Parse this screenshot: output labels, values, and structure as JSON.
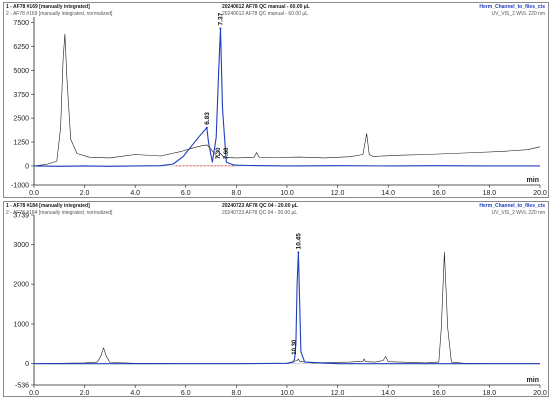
{
  "panels": [
    {
      "header": {
        "series1_label": "1 - AF78 #169  [manually integrated]",
        "series2_label": "2 - AF78 #169  [manually integrated, normalized]",
        "run1": "20240612 AF78 QC manual  -  60.00 µL",
        "run2": "20240612 AF78 QC manual  -  60.00 µL",
        "channel1": "Herm_Channel_to_files_cts",
        "channel2": "UV_VIS_2 WVL 220 nm"
      },
      "y_tick_labels": [
        "7500",
        "6250",
        "5000",
        "3750",
        "2500",
        "1250",
        "0",
        "-1000"
      ],
      "x_tick_labels": [
        "0.0",
        "2.0",
        "4.0",
        "6.0",
        "8.0",
        "10.0",
        "12.0",
        "14.0",
        "16.0",
        "18.0",
        "20.0"
      ],
      "x_unit": "min",
      "peak_labels": [
        "6.83",
        "7.37",
        "7.30",
        "7.60"
      ]
    },
    {
      "header": {
        "series1_label": "1 - AF78 #184  [manually integrated]",
        "series2_label": "2 - AF78 #184  [manually integrated, normalized]",
        "run1": "20240723 AF78 QC 04  -  20.00 µL",
        "run2": "20240723 AF78 QC 04  -  20.00 µL",
        "channel1": "Herm_Channel_to_files_cts",
        "channel2": "UV_VIS_2 WVL 220 nm"
      },
      "y_tick_labels": [
        "3739",
        "3000",
        "2000",
        "1000",
        "0",
        "-536"
      ],
      "x_tick_labels": [
        "0.0",
        "2.0",
        "4.0",
        "6.0",
        "8.0",
        "10.0",
        "12.0",
        "14.0",
        "16.0",
        "18.0",
        "20.0"
      ],
      "x_unit": "min",
      "peak_labels": [
        "10.45",
        "10.30"
      ]
    }
  ],
  "colors": {
    "black_trace": "#1a1a1a",
    "blue_trace": "#1f3fbf",
    "baseline_red": "#e03030",
    "axis": "#222222"
  },
  "chart_data": [
    {
      "type": "line",
      "xlabel": "min",
      "xlim": [
        0,
        20
      ],
      "ylim": [
        -1000,
        7800
      ],
      "x_ticks": [
        0,
        2,
        4,
        6,
        8,
        10,
        12,
        14,
        16,
        18,
        20
      ],
      "y_ticks": [
        7500,
        6250,
        5000,
        3750,
        2500,
        1250,
        0,
        -1000
      ],
      "series": [
        {
          "name": "1 - AF78 #169  [manually integrated]",
          "color": "#1a1a1a",
          "x": [
            0.0,
            0.5,
            0.9,
            1.05,
            1.15,
            1.22,
            1.3,
            1.45,
            1.7,
            2.2,
            3.0,
            4.0,
            5.0,
            5.8,
            6.3,
            6.6,
            6.83,
            6.95,
            7.1,
            7.25,
            7.37,
            7.5,
            8.0,
            8.7,
            8.8,
            8.9,
            9.5,
            10.5,
            11.5,
            12.5,
            13.0,
            13.15,
            13.25,
            13.4,
            14.5,
            15.5,
            16.5,
            17.5,
            18.5,
            19.5,
            20.0
          ],
          "values": [
            0,
            80,
            250,
            2000,
            5600,
            6900,
            4600,
            1400,
            650,
            450,
            420,
            600,
            520,
            750,
            950,
            1050,
            1100,
            950,
            700,
            500,
            650,
            450,
            420,
            450,
            700,
            450,
            440,
            460,
            420,
            480,
            600,
            1700,
            600,
            500,
            560,
            600,
            650,
            700,
            760,
            850,
            1000
          ]
        },
        {
          "name": "2 - AF78 #169  [manually integrated, normalized]",
          "color": "#1f3fbf",
          "x": [
            0.0,
            1.0,
            2.0,
            3.0,
            4.0,
            5.0,
            5.5,
            5.9,
            6.2,
            6.5,
            6.7,
            6.83,
            6.9,
            7.05,
            7.2,
            7.3,
            7.37,
            7.45,
            7.6,
            7.9,
            8.5,
            10.0,
            12.0,
            14.0,
            16.0,
            18.0,
            20.0
          ],
          "values": [
            0,
            -20,
            0,
            -20,
            0,
            10,
            100,
            500,
            1000,
            1500,
            1800,
            2000,
            1200,
            200,
            1500,
            5000,
            7200,
            3000,
            200,
            40,
            20,
            0,
            10,
            0,
            10,
            0,
            0
          ]
        }
      ],
      "annotations": [
        {
          "label": "6.83",
          "x": 6.83,
          "y": 2000
        },
        {
          "label": "7.37",
          "x": 7.37,
          "y": 7200
        },
        {
          "label": "7.30",
          "x": 7.3,
          "y": 300
        },
        {
          "label": "7.60",
          "x": 7.6,
          "y": 300
        }
      ]
    },
    {
      "type": "line",
      "xlabel": "min",
      "xlim": [
        0,
        20
      ],
      "ylim": [
        -536,
        3739
      ],
      "x_ticks": [
        0,
        2,
        4,
        6,
        8,
        10,
        12,
        14,
        16,
        18,
        20
      ],
      "y_ticks": [
        3739,
        3000,
        2000,
        1000,
        0,
        -536
      ],
      "series": [
        {
          "name": "1 - AF78 #184  [manually integrated]",
          "color": "#1a1a1a",
          "x": [
            0.0,
            1.0,
            2.0,
            2.5,
            2.65,
            2.75,
            2.85,
            3.0,
            4.0,
            6.0,
            8.0,
            10.0,
            10.4,
            10.45,
            10.5,
            11.0,
            12.5,
            13.0,
            13.05,
            13.1,
            13.5,
            13.8,
            13.9,
            14.0,
            15.5,
            16.0,
            16.1,
            16.22,
            16.35,
            16.5,
            17.0,
            18.0,
            19.0,
            20.0
          ],
          "values": [
            0,
            10,
            20,
            40,
            200,
            400,
            200,
            30,
            10,
            0,
            0,
            10,
            80,
            120,
            60,
            20,
            40,
            60,
            120,
            50,
            40,
            80,
            180,
            50,
            20,
            40,
            900,
            2800,
            900,
            40,
            10,
            0,
            0,
            0
          ]
        },
        {
          "name": "2 - AF78 #184  [manually integrated, normalized]",
          "color": "#1f3fbf",
          "x": [
            0.0,
            2.0,
            4.0,
            6.0,
            8.0,
            10.0,
            10.25,
            10.3,
            10.35,
            10.4,
            10.45,
            10.5,
            10.55,
            10.7,
            12.0,
            14.0,
            16.0,
            18.0,
            20.0
          ],
          "values": [
            0,
            0,
            0,
            0,
            0,
            10,
            40,
            120,
            500,
            2000,
            2800,
            1500,
            300,
            40,
            0,
            0,
            0,
            0,
            0
          ]
        }
      ],
      "annotations": [
        {
          "label": "10.45",
          "x": 10.45,
          "y": 2800
        },
        {
          "label": "10.30",
          "x": 10.3,
          "y": 200
        }
      ]
    }
  ]
}
